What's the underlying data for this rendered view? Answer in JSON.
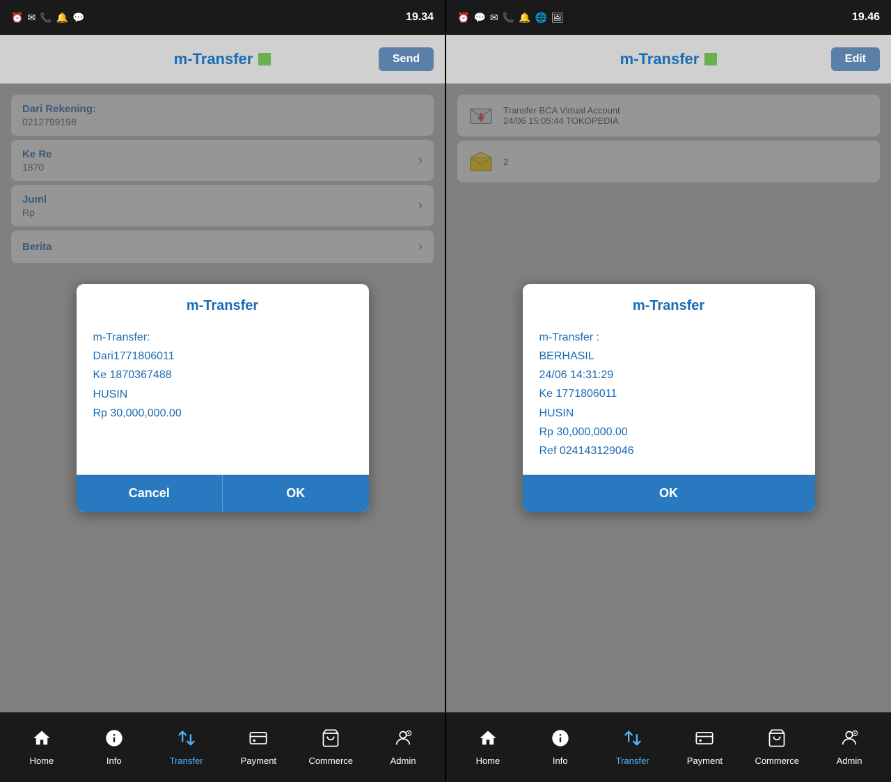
{
  "left_panel": {
    "status_bar": {
      "time": "19.34",
      "icons": [
        "clock",
        "gmail",
        "phone",
        "notification",
        "whatsapp"
      ]
    },
    "header": {
      "title": "m-Transfer",
      "green_square": true,
      "button_label": "Send"
    },
    "form": {
      "dari_rekening_label": "Dari Rekening:",
      "dari_rekening_value": "0212799198",
      "ke_rekening_label": "Ke Re",
      "ke_rekening_value": "1870",
      "jumlah_label": "Juml",
      "rp_label": "Rp",
      "berita_label": "Berita"
    },
    "dialog": {
      "title": "m-Transfer",
      "body_lines": [
        "m-Transfer:",
        "Dari1771806011",
        "Ke 1870367488",
        "HUSIN",
        "Rp 30,000,000.00"
      ],
      "cancel_label": "Cancel",
      "ok_label": "OK"
    },
    "nav": {
      "items": [
        {
          "label": "Home",
          "icon": "home",
          "active": false
        },
        {
          "label": "Info",
          "icon": "info",
          "active": false
        },
        {
          "label": "Transfer",
          "icon": "transfer",
          "active": true
        },
        {
          "label": "Payment",
          "icon": "payment",
          "active": false
        },
        {
          "label": "Commerce",
          "icon": "commerce",
          "active": false
        },
        {
          "label": "Admin",
          "icon": "admin",
          "active": false
        }
      ]
    }
  },
  "right_panel": {
    "status_bar": {
      "time": "19.46",
      "icons": [
        "clock",
        "whatsapp",
        "gmail",
        "phone",
        "notification",
        "globe",
        "image"
      ]
    },
    "header": {
      "title": "m-Transfer",
      "green_square": true,
      "button_label": "Edit"
    },
    "notifications": [
      {
        "icon": "letter-down",
        "text": "Transfer BCA Virtual Account\n24/06 15:05:44 TOKOPEDIA"
      },
      {
        "icon": "letter-open",
        "text": "2"
      }
    ],
    "dialog": {
      "title": "m-Transfer",
      "body_lines": [
        "m-Transfer :",
        "BERHASIL",
        "24/06 14:31:29",
        "Ke 1771806011",
        "HUSIN",
        "Rp 30,000,000.00",
        "Ref 024143129046"
      ],
      "ok_label": "OK"
    },
    "nav": {
      "items": [
        {
          "label": "Home",
          "icon": "home",
          "active": false
        },
        {
          "label": "Info",
          "icon": "info",
          "active": false
        },
        {
          "label": "Transfer",
          "icon": "transfer",
          "active": true
        },
        {
          "label": "Payment",
          "icon": "payment",
          "active": false
        },
        {
          "label": "Commerce",
          "icon": "commerce",
          "active": false
        },
        {
          "label": "Admin",
          "icon": "admin",
          "active": false
        }
      ]
    }
  }
}
